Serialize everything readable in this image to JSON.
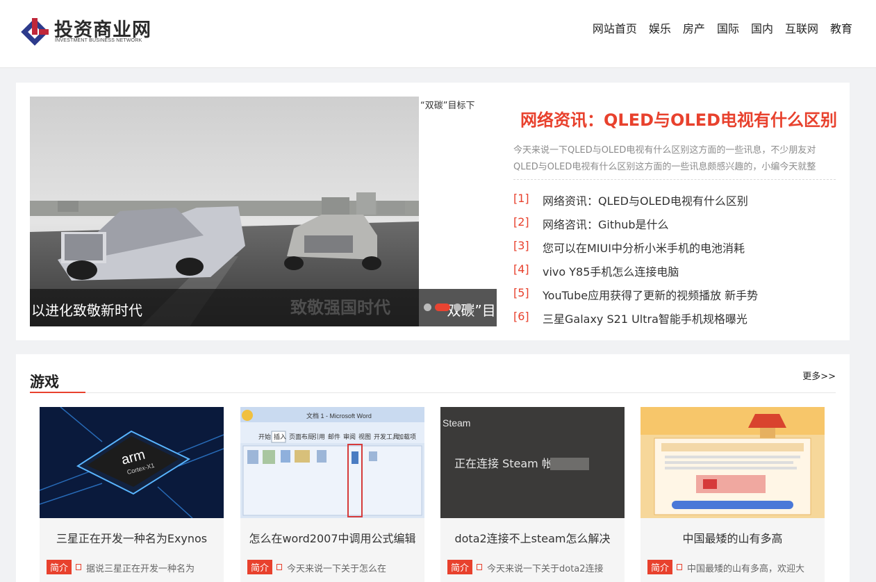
{
  "site": {
    "logo_title": "投资商业网",
    "logo_subtitle": "INVESTMENT BUSINESS NETWORK",
    "nav": [
      "网站首页",
      "娱乐",
      "房产",
      "国际",
      "国内",
      "互联网",
      "教育"
    ]
  },
  "slider": {
    "caption": "以进化致敬新时代",
    "next_caption": "“双碳”目",
    "broken_image_alt": "“双碳”目标下",
    "watermark": "致敬强国时代",
    "dot_count": 4,
    "active_dot": 1
  },
  "featured": {
    "headline": "网络资讯：QLED与OLED电视有什么区别",
    "summary": "今天来说一下QLED与OLED电视有什么区别这方面的一些讯息，不少朋友对QLED与OLED电视有什么区别这方面的一些讯息颇感兴趣的，小编今天就整",
    "list": [
      {
        "num": "[1]",
        "text": "网络资讯：QLED与OLED电视有什么区别"
      },
      {
        "num": "[2]",
        "text": "网络咨讯：Github是什么"
      },
      {
        "num": "[3]",
        "text": "您可以在MIUI中分析小米手机的电池消耗"
      },
      {
        "num": "[4]",
        "text": "vivo Y85手机怎么连接电脑"
      },
      {
        "num": "[5]",
        "text": "YouTube应用获得了更新的视频播放 新手势"
      },
      {
        "num": "[6]",
        "text": "三星Galaxy S21 Ultra智能手机规格曝光"
      }
    ]
  },
  "games": {
    "title": "游戏",
    "more": "更多>>",
    "tag_label": "简介",
    "cards": [
      {
        "title": "三星正在开发一种名为Exynos",
        "desc": "据说三星正在开发一种名为",
        "chip_text": "arm",
        "chip_sub": "Cortex-X1"
      },
      {
        "title": "怎么在word2007中调用公式编辑",
        "desc": "今天来说一下关于怎么在",
        "word_title": "文档 1 - Microsoft Word",
        "word_tabs": [
          "开始",
          "插入",
          "页面布局",
          "引用",
          "邮件",
          "审阅",
          "视图",
          "开发工具",
          "加载项"
        ]
      },
      {
        "title": "dota2连接不上steam怎么解决",
        "desc": "今天来说一下关于dota2连接",
        "steam_label": "Steam",
        "steam_status": "正在连接 Steam 帐号："
      },
      {
        "title": "中国最矮的山有多高",
        "desc": "中国最矮的山有多高，欢迎大"
      }
    ]
  },
  "colors": {
    "accent": "#e8412d",
    "logo_blue": "#2d3b8c",
    "logo_red": "#c0273a"
  }
}
